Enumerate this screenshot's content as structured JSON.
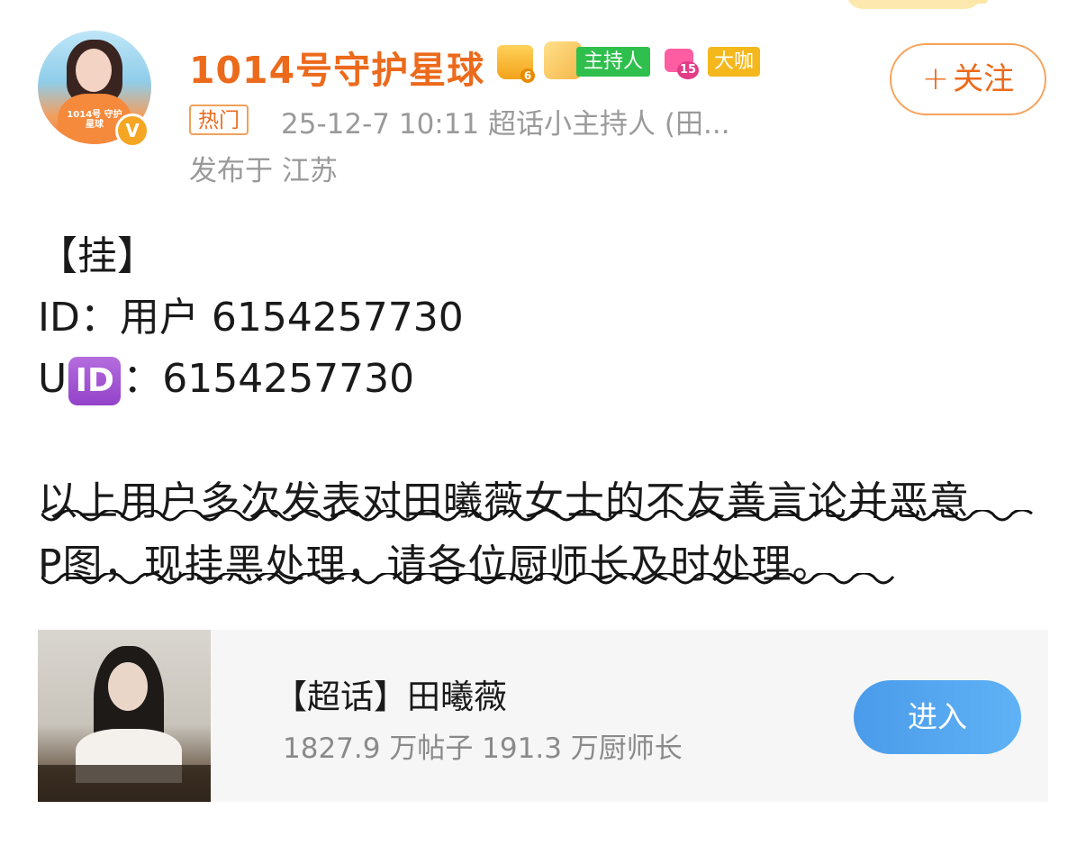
{
  "author": {
    "name": "1014号守护星球",
    "avatar_caption": "1014号 守护星球",
    "verified_mark": "V",
    "badges": {
      "crown_level": "6",
      "host_label": "主持人",
      "gem_level": "15",
      "daka_label": "大咖"
    }
  },
  "follow_button": {
    "label": "关注",
    "plus": "+"
  },
  "meta": {
    "hot_tag": "热门",
    "time_and_source": "25-12-7 10:11  超话小主持人 (田...",
    "location": "发布于 江苏"
  },
  "post": {
    "line1": "【挂】",
    "line2": "ID：用户 6154257730",
    "line3_prefix": "U",
    "line3_emoji": "ID",
    "line3_suffix": "：6154257730",
    "para1": "以上用户多次发表对田曦薇女士的不友善言论并恶意",
    "para2": "P图，现挂黑处理，请各位厨师长及时处理。"
  },
  "topic": {
    "title": "【超话】田曦薇",
    "stats": "1827.9 万帖子 191.3 万厨师长",
    "enter_label": "进入"
  }
}
